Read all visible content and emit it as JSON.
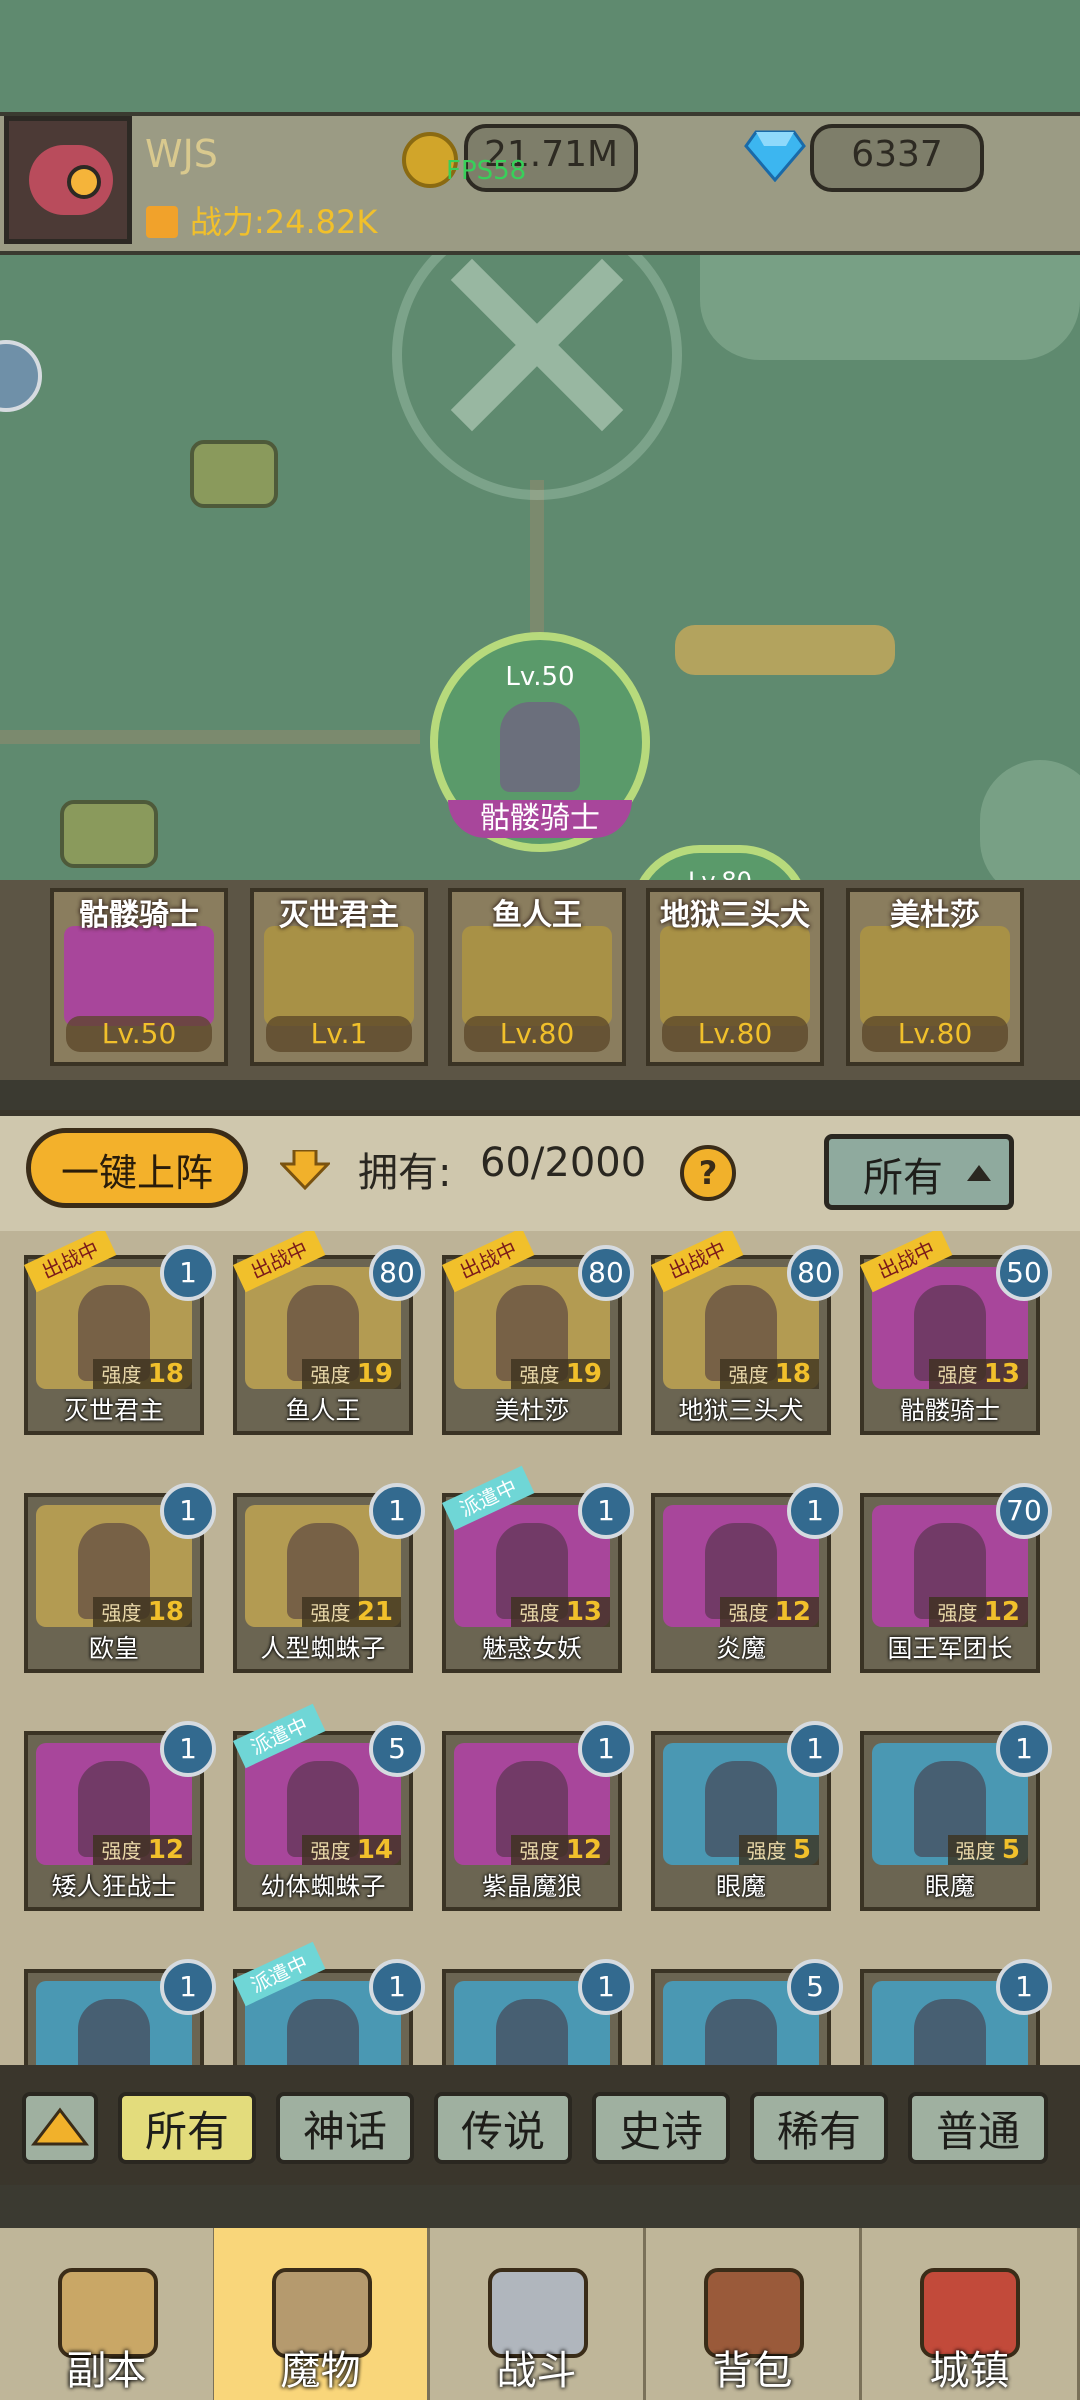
{
  "header": {
    "player_name": "WJS",
    "gold": "21.71M",
    "fps": "FPS58",
    "gems": "6337",
    "battle_power": "战力:24.82K"
  },
  "map": {
    "selected_level": "Lv.50",
    "selected_name": "骷髅骑士",
    "partial_level": "Lv.80"
  },
  "team": [
    {
      "name": "骷髅骑士",
      "level": "Lv.50",
      "color": "#a8469b"
    },
    {
      "name": "灭世君主",
      "level": "Lv.1",
      "color": "#a89146"
    },
    {
      "name": "鱼人王",
      "level": "Lv.80",
      "color": "#a89146"
    },
    {
      "name": "地狱三头犬",
      "level": "Lv.80",
      "color": "#a89146"
    },
    {
      "name": "美杜莎",
      "level": "Lv.80",
      "color": "#a89146"
    }
  ],
  "toolbar": {
    "deploy_label": "一键上阵",
    "own_label": "拥有:",
    "own_value": "60/2000",
    "help": "?",
    "sort_label": "所有"
  },
  "tags": {
    "fighting": "出战中",
    "dispatched": "派遣中"
  },
  "monsters": [
    {
      "name": "灭世君主",
      "level": "1",
      "power": "18",
      "power_label": "强度",
      "bg": "#b39b52",
      "tag": "出战中"
    },
    {
      "name": "鱼人王",
      "level": "80",
      "power": "19",
      "power_label": "强度",
      "bg": "#b39b52",
      "tag": "出战中"
    },
    {
      "name": "美杜莎",
      "level": "80",
      "power": "19",
      "power_label": "强度",
      "bg": "#b39b52",
      "tag": "出战中"
    },
    {
      "name": "地狱三头犬",
      "level": "80",
      "power": "18",
      "power_label": "强度",
      "bg": "#b39b52",
      "tag": "出战中"
    },
    {
      "name": "骷髅骑士",
      "level": "50",
      "power": "13",
      "power_label": "强度",
      "bg": "#a8469b",
      "tag": "出战中"
    },
    {
      "name": "欧皇",
      "level": "1",
      "power": "18",
      "power_label": "强度",
      "bg": "#b39b52",
      "tag": ""
    },
    {
      "name": "人型蜘蛛子",
      "level": "1",
      "power": "21",
      "power_label": "强度",
      "bg": "#b39b52",
      "tag": ""
    },
    {
      "name": "魅惑女妖",
      "level": "1",
      "power": "13",
      "power_label": "强度",
      "bg": "#a8469b",
      "tag": "派遣中"
    },
    {
      "name": "炎魔",
      "level": "1",
      "power": "12",
      "power_label": "强度",
      "bg": "#a8469b",
      "tag": ""
    },
    {
      "name": "国王军团长",
      "level": "70",
      "power": "12",
      "power_label": "强度",
      "bg": "#a8469b",
      "tag": ""
    },
    {
      "name": "矮人狂战士",
      "level": "1",
      "power": "12",
      "power_label": "强度",
      "bg": "#a8469b",
      "tag": ""
    },
    {
      "name": "幼体蜘蛛子",
      "level": "5",
      "power": "14",
      "power_label": "强度",
      "bg": "#a8469b",
      "tag": "派遣中"
    },
    {
      "name": "紫晶魔狼",
      "level": "1",
      "power": "12",
      "power_label": "强度",
      "bg": "#a8469b",
      "tag": ""
    },
    {
      "name": "眼魔",
      "level": "1",
      "power": "5",
      "power_label": "强度",
      "bg": "#4a98b3",
      "tag": ""
    },
    {
      "name": "眼魔",
      "level": "1",
      "power": "5",
      "power_label": "强度",
      "bg": "#4a98b3",
      "tag": ""
    },
    {
      "name": "",
      "level": "1",
      "power": "",
      "power_label": "",
      "bg": "#4a98b3",
      "tag": ""
    },
    {
      "name": "",
      "level": "1",
      "power": "",
      "power_label": "",
      "bg": "#4a98b3",
      "tag": "派遣中"
    },
    {
      "name": "",
      "level": "1",
      "power": "",
      "power_label": "",
      "bg": "#4a98b3",
      "tag": ""
    },
    {
      "name": "",
      "level": "5",
      "power": "",
      "power_label": "",
      "bg": "#4a98b3",
      "tag": ""
    },
    {
      "name": "",
      "level": "1",
      "power": "",
      "power_label": "",
      "bg": "#4a98b3",
      "tag": ""
    }
  ],
  "filters": [
    "所有",
    "神话",
    "传说",
    "史诗",
    "稀有",
    "普通"
  ],
  "nav": [
    {
      "label": "副本",
      "icon": "map-icon"
    },
    {
      "label": "魔物",
      "icon": "helmet-icon"
    },
    {
      "label": "战斗",
      "icon": "swords-icon"
    },
    {
      "label": "背包",
      "icon": "backpack-icon"
    },
    {
      "label": "城镇",
      "icon": "castle-icon"
    }
  ],
  "colors": {
    "accent": "#f1c02b",
    "active_nav": "#f9d67a",
    "level_badge": "#336a8f"
  }
}
